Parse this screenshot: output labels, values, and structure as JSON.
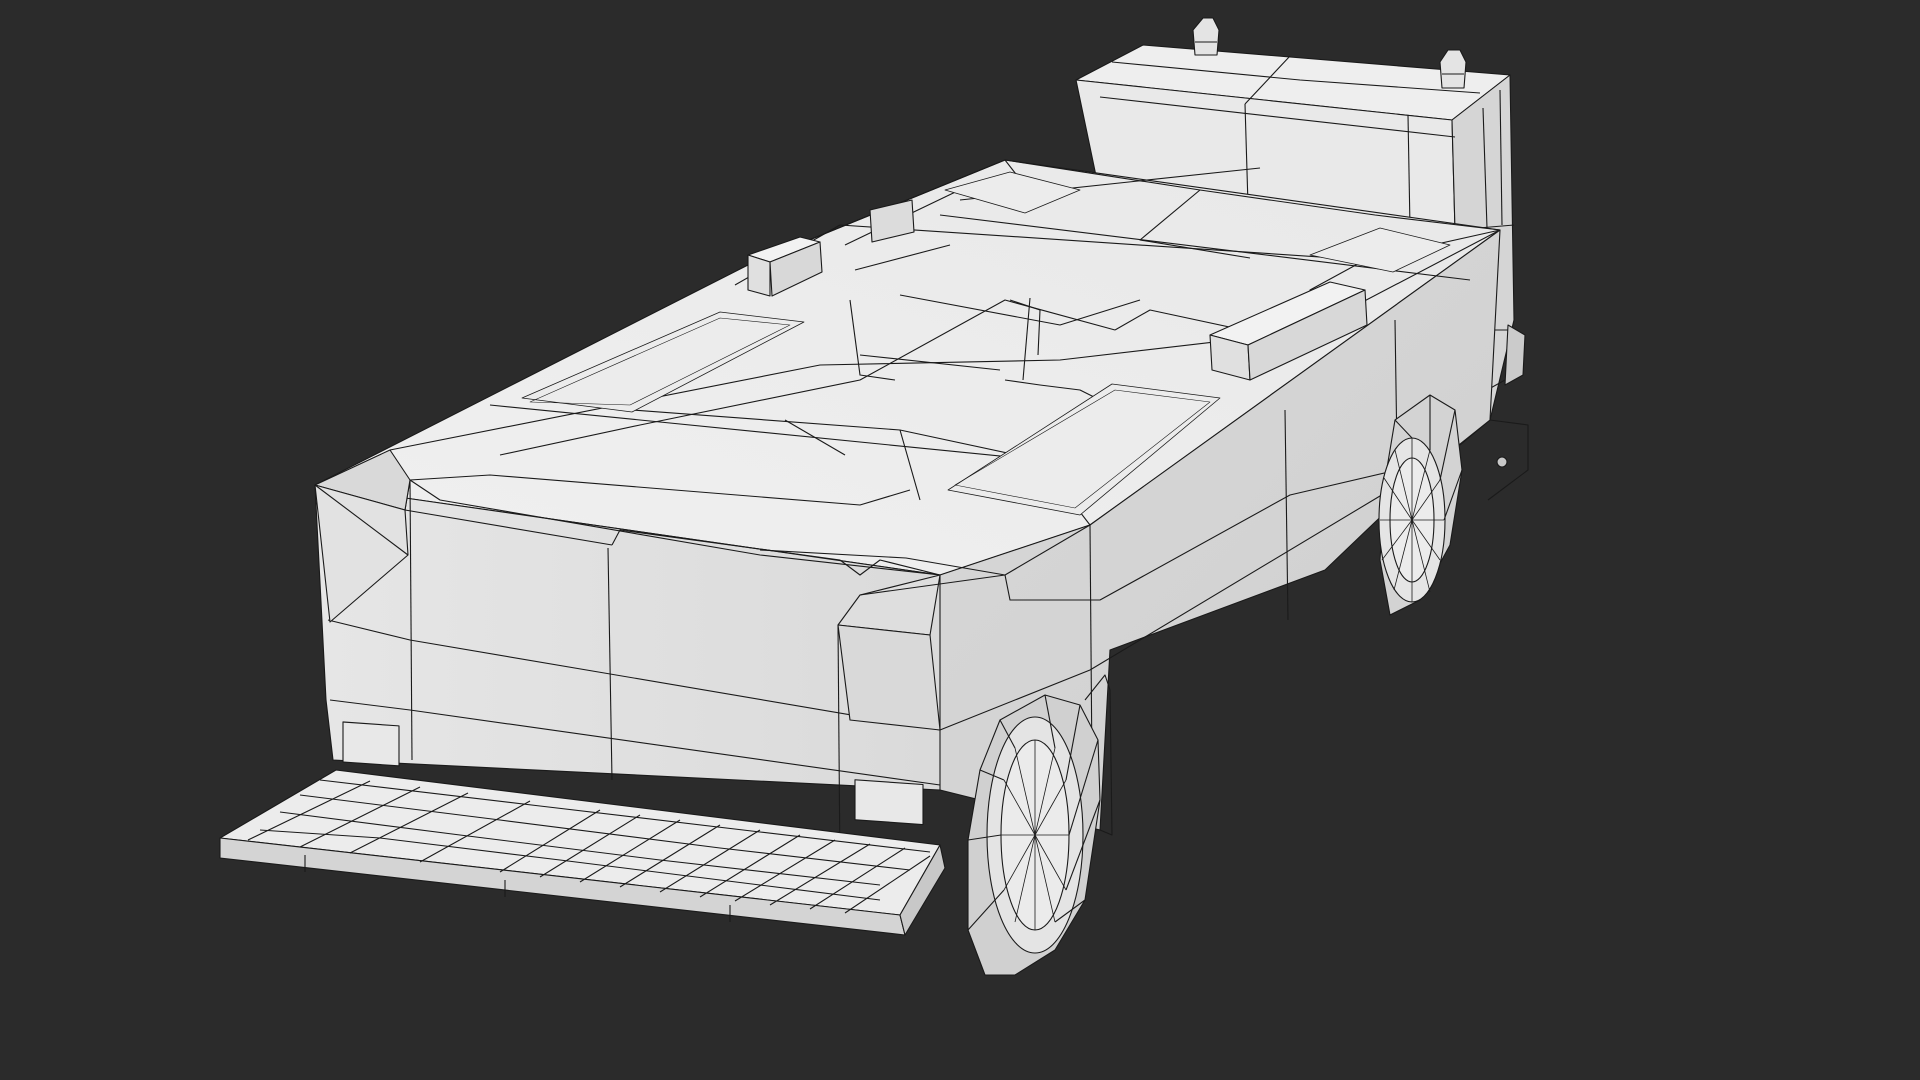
{
  "viewport": {
    "background": "#2b2b2b",
    "shading": "solid-grey-with-wireframe",
    "colors": {
      "face_light": "#efefef",
      "face_mid": "#e3e3e3",
      "face_dark": "#d4d4d4",
      "face_shadow": "#c9c9c9",
      "edge": "#1a1a1a"
    }
  },
  "model": {
    "type": "low-poly truck",
    "parts": [
      "cab",
      "cargo-box",
      "rear-bumper-step",
      "rear-wheel",
      "front-wheel",
      "roof-lights",
      "tail-lights"
    ]
  }
}
